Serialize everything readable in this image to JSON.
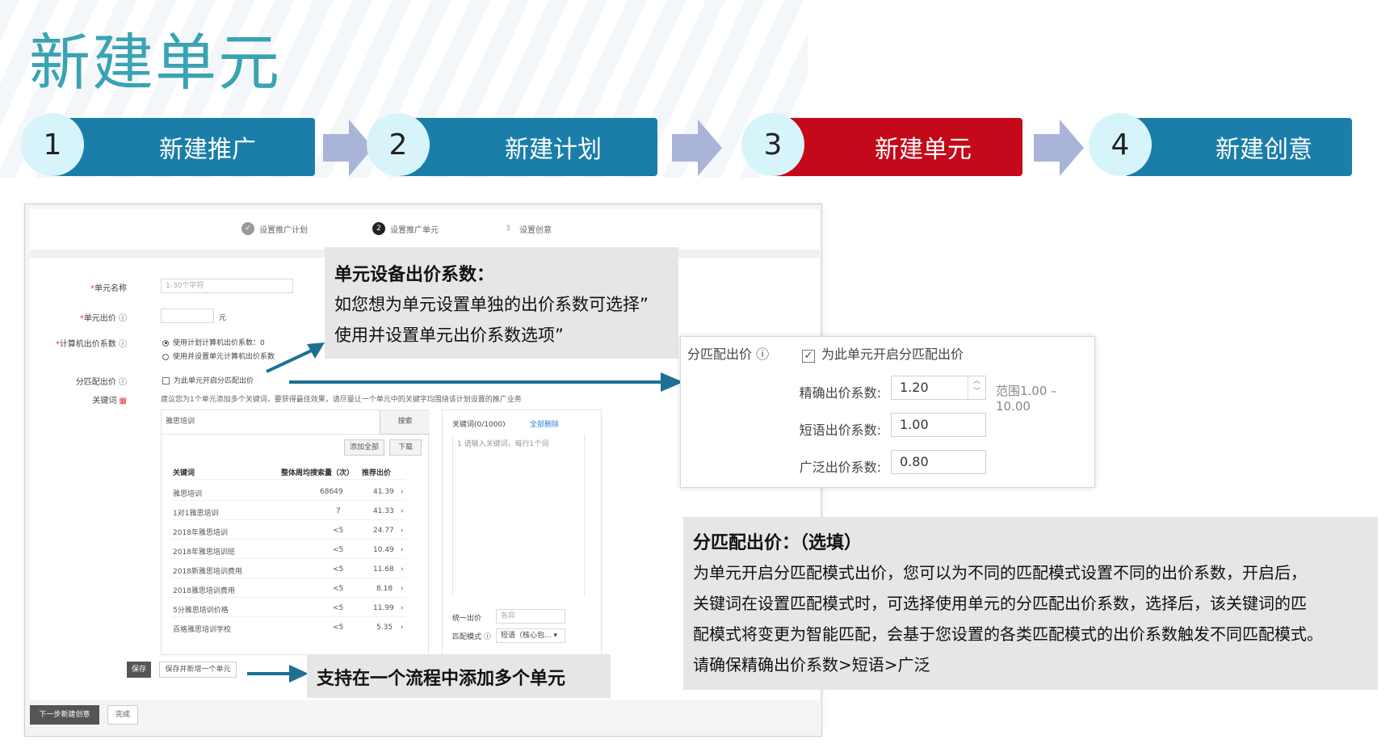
{
  "title": "新建单元",
  "steps": [
    {
      "num": "1",
      "label": "新建推广",
      "color": "#1a7ea8"
    },
    {
      "num": "2",
      "label": "新建计划",
      "color": "#1a7ea8"
    },
    {
      "num": "3",
      "label": "新建单元",
      "color": "#c40a1a"
    },
    {
      "num": "4",
      "label": "新建创意",
      "color": "#1a7ea8"
    }
  ],
  "wizard": {
    "step1": "设置推广计划",
    "step2_num": "2",
    "step2": "设置推广单元",
    "step3_num": "3",
    "step3": "设置创意"
  },
  "form": {
    "unit_name_label": "单元名称",
    "unit_name_placeholder": "1-30个字符",
    "unit_bid_label": "单元出价",
    "unit_bid_unit": "元",
    "pc_coef_label": "计算机出价系数",
    "pc_coef_opt1": "使用计划计算机出价系数：0",
    "pc_coef_opt2": "使用并设置单元计算机出价系数",
    "match_bid_label": "分匹配出价",
    "match_bid_checkbox": "为此单元开启分匹配出价",
    "keyword_label": "关键词",
    "keyword_hint": "建议您为1个单元添加多个关键词，要获得最佳效果，请尽量让一个单元中的关键字均围绕该计划设置的推广业务",
    "search_value": "雅思培训",
    "search_button": "搜索",
    "add_all_button": "添加全部",
    "download_button": "下载",
    "table_headers": [
      "关键词",
      "整体周均搜索量（次）",
      "推荐出价"
    ],
    "rows": [
      {
        "kw": "雅思培训",
        "vol": "68649",
        "bid": "41.39"
      },
      {
        "kw": "1对1雅思培训",
        "vol": "7",
        "bid": "41.33"
      },
      {
        "kw": "2018年雅思培训",
        "vol": "<5",
        "bid": "24.77"
      },
      {
        "kw": "2018年雅思培训班",
        "vol": "<5",
        "bid": "10.49"
      },
      {
        "kw": "2018新雅思培训费用",
        "vol": "<5",
        "bid": "11.68"
      },
      {
        "kw": "2018雅思培训费用",
        "vol": "<5",
        "bid": "8.18"
      },
      {
        "kw": "5分雅思培训价格",
        "vol": "<5",
        "bid": "11.99"
      },
      {
        "kw": "百格雅思培训学校",
        "vol": "<5",
        "bid": "5.35"
      }
    ],
    "selected_header": "关键词(0/1000)",
    "delete_all": "全部删除",
    "selected_placeholder": "请输入关键词，每行1个词",
    "unified_bid_label": "统一出价",
    "unified_bid_placeholder": "各异",
    "match_mode_label": "匹配模式",
    "match_mode_value": "短语（核心包...",
    "save_button": "保存",
    "save_add_button": "保存并新增一个单元",
    "next_button": "下一步新建创意",
    "done_button": "完成"
  },
  "callout_unit": {
    "title": "单元设备出价系数：",
    "line1": "如您想为单元设置单独的出价系数可选择”",
    "line2": "使用并设置单元出价系数选项”"
  },
  "callout_multi": "支持在一个流程中添加多个单元",
  "bid_panel": {
    "label": "分匹配出价",
    "checkbox": "为此单元开启分匹配出价",
    "exact_label": "精确出价系数:",
    "exact_value": "1.20",
    "range": "范围1.00 – 10.00",
    "phrase_label": "短语出价系数:",
    "phrase_value": "1.00",
    "broad_label": "广泛出价系数:",
    "broad_value": "0.80"
  },
  "callout_match": {
    "title": "分匹配出价：（选填）",
    "line1": "为单元开启分匹配模式出价，您可以为不同的匹配模式设置不同的出价系数，开启后，",
    "line2": "关键词在设置匹配模式时，可选择使用单元的分匹配出价系数，选择后，该关键词的匹",
    "line3": "配模式将变更为智能匹配，会基于您设置的各类匹配模式的出价系数触发不同匹配模式。",
    "line4": "请确保精确出价系数>短语>广泛"
  },
  "colors": {
    "teal_title": "#3aa3b3",
    "step_blue": "#1a7ea8",
    "step_red": "#c40a1a",
    "arrow": "#1f6f95"
  }
}
